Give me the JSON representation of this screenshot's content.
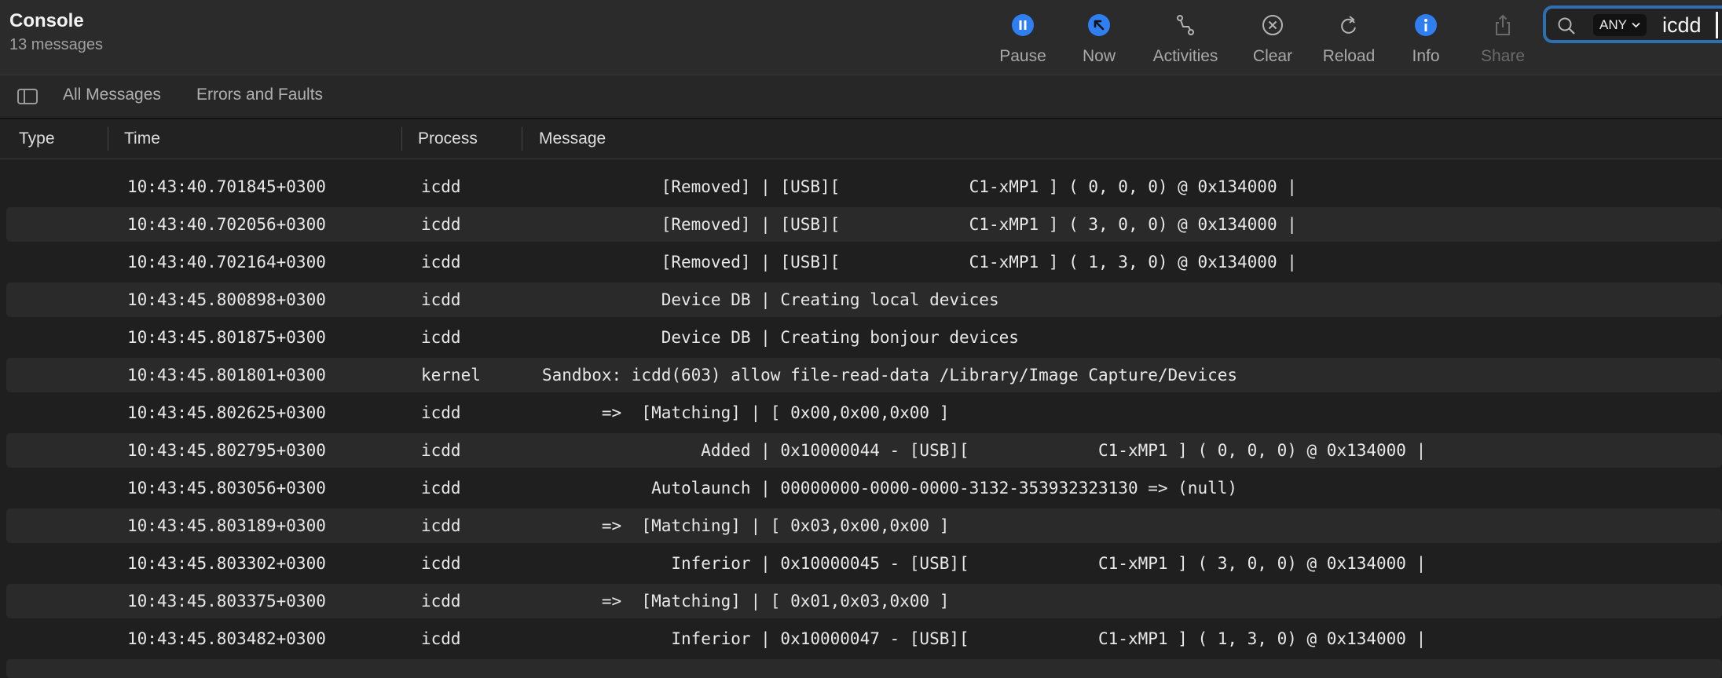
{
  "app": {
    "title": "Console",
    "subtitle": "13 messages"
  },
  "toolbar": {
    "buttons": [
      {
        "label": "Pause",
        "icon": "pause-circle-icon"
      },
      {
        "label": "Now",
        "icon": "arrow-up-left-circle-icon"
      },
      {
        "label": "Activities",
        "icon": "activities-icon"
      },
      {
        "label": "Clear",
        "icon": "clear-x-circle-icon"
      },
      {
        "label": "Reload",
        "icon": "reload-icon"
      },
      {
        "label": "Info",
        "icon": "info-circle-icon"
      },
      {
        "label": "Share",
        "icon": "share-icon",
        "disabled": true
      }
    ],
    "accent": "#2f7ff0"
  },
  "search": {
    "scope": "ANY",
    "term": "icdd"
  },
  "filters": {
    "all_messages": "All Messages",
    "errors_faults": "Errors and Faults"
  },
  "columns": {
    "type": "Type",
    "time": "Time",
    "process": "Process",
    "message": "Message"
  },
  "rows": [
    {
      "time": "10:43:40.701845+0300",
      "process": "icdd",
      "message": "            [Removed] | [USB][             C1-xMP1 ] ( 0, 0, 0) @ 0x134000 |"
    },
    {
      "time": "10:43:40.702056+0300",
      "process": "icdd",
      "message": "            [Removed] | [USB][             C1-xMP1 ] ( 3, 0, 0) @ 0x134000 |"
    },
    {
      "time": "10:43:40.702164+0300",
      "process": "icdd",
      "message": "            [Removed] | [USB][             C1-xMP1 ] ( 1, 3, 0) @ 0x134000 |"
    },
    {
      "time": "10:43:45.800898+0300",
      "process": "icdd",
      "message": "            Device DB | Creating local devices"
    },
    {
      "time": "10:43:45.801875+0300",
      "process": "icdd",
      "message": "            Device DB | Creating bonjour devices"
    },
    {
      "time": "10:43:45.801801+0300",
      "process": "kernel",
      "message": "Sandbox: icdd(603) allow file-read-data /Library/Image Capture/Devices"
    },
    {
      "time": "10:43:45.802625+0300",
      "process": "icdd",
      "message": "      =>  [Matching] | [ 0x00,0x00,0x00 ]"
    },
    {
      "time": "10:43:45.802795+0300",
      "process": "icdd",
      "message": "                Added | 0x10000044 - [USB][             C1-xMP1 ] ( 0, 0, 0) @ 0x134000 |"
    },
    {
      "time": "10:43:45.803056+0300",
      "process": "icdd",
      "message": "           Autolaunch | 00000000-0000-0000-3132-353932323130 => (null)"
    },
    {
      "time": "10:43:45.803189+0300",
      "process": "icdd",
      "message": "      =>  [Matching] | [ 0x03,0x00,0x00 ]"
    },
    {
      "time": "10:43:45.803302+0300",
      "process": "icdd",
      "message": "             Inferior | 0x10000045 - [USB][             C1-xMP1 ] ( 3, 0, 0) @ 0x134000 |"
    },
    {
      "time": "10:43:45.803375+0300",
      "process": "icdd",
      "message": "      =>  [Matching] | [ 0x01,0x03,0x00 ]"
    },
    {
      "time": "10:43:45.803482+0300",
      "process": "icdd",
      "message": "             Inferior | 0x10000047 - [USB][             C1-xMP1 ] ( 1, 3, 0) @ 0x134000 |"
    }
  ]
}
